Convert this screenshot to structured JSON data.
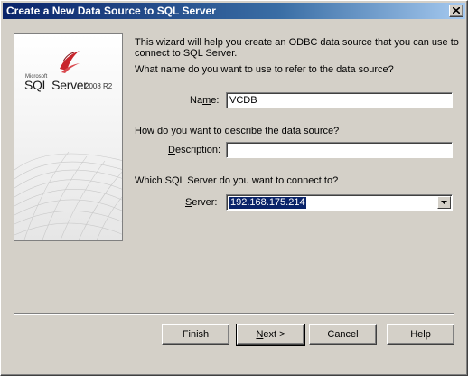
{
  "window": {
    "title": "Create a New Data Source to SQL Server"
  },
  "logo": {
    "microsoft": "Microsoft",
    "product": "SQL Server",
    "version": "2008 R2"
  },
  "intro_text": "This wizard will help you create an ODBC data source that you can use to connect to SQL Server.",
  "name_section": {
    "question": "What name do you want to use to refer to the data source?",
    "label_pre": "Na",
    "label_key": "m",
    "label_post": "e:",
    "value": "VCDB"
  },
  "description_section": {
    "question": "How do you want to describe the data source?",
    "label_key": "D",
    "label_post": "escription:",
    "value": ""
  },
  "server_section": {
    "question": "Which SQL Server do you want to connect to?",
    "label_key": "S",
    "label_post": "erver:",
    "value": "192.168.175.214"
  },
  "buttons": {
    "finish": "Finish",
    "next_key": "N",
    "next_post": "ext >",
    "cancel": "Cancel",
    "help": "Help"
  }
}
